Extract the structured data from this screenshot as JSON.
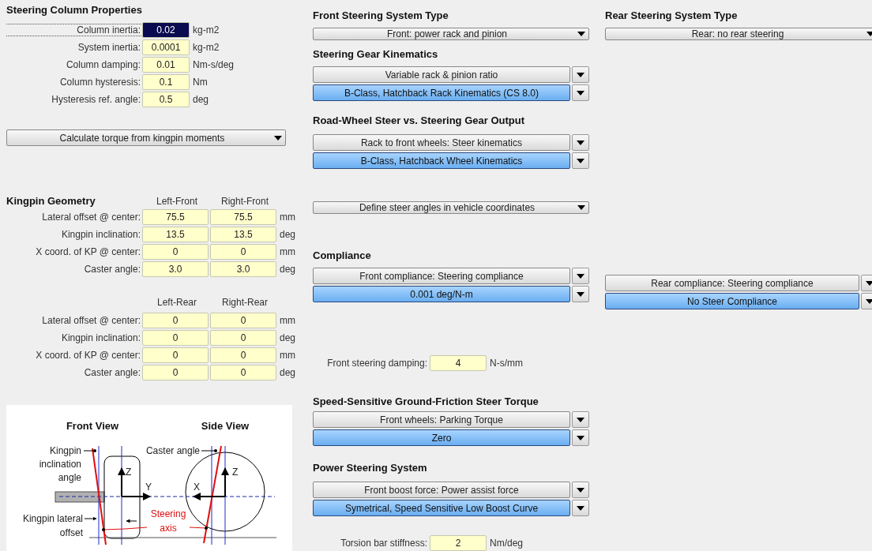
{
  "column_properties": {
    "title": "Steering Column Properties",
    "fields": [
      {
        "label": "Column inertia:",
        "value": "0.02",
        "unit": "kg-m2",
        "focused": true
      },
      {
        "label": "System inertia:",
        "value": "0.0001",
        "unit": "kg-m2",
        "focused": false
      },
      {
        "label": "Column damping:",
        "value": "0.01",
        "unit": "Nm-s/deg",
        "focused": false
      },
      {
        "label": "Column hysteresis:",
        "value": "0.1",
        "unit": "Nm",
        "focused": false
      },
      {
        "label": "Hysteresis ref. angle:",
        "value": "0.5",
        "unit": "deg",
        "focused": false
      }
    ],
    "dropdown": {
      "text": "Calculate torque from kingpin moments",
      "kind": "menu"
    }
  },
  "kingpin_geometry": {
    "title": "Kingpin Geometry",
    "front_headers": [
      "Left-Front",
      "Right-Front"
    ],
    "front_rows": [
      {
        "label": "Lateral offset @ center:",
        "values": [
          "75.5",
          "75.5"
        ],
        "unit": "mm"
      },
      {
        "label": "Kingpin inclination:",
        "values": [
          "13.5",
          "13.5"
        ],
        "unit": "deg"
      },
      {
        "label": "X coord. of KP @ center:",
        "values": [
          "0",
          "0"
        ],
        "unit": "mm"
      },
      {
        "label": "Caster angle:",
        "values": [
          "3.0",
          "3.0"
        ],
        "unit": "deg"
      }
    ],
    "rear_headers": [
      "Left-Rear",
      "Right-Rear"
    ],
    "rear_rows": [
      {
        "label": "Lateral offset @ center:",
        "values": [
          "0",
          "0"
        ],
        "unit": "mm"
      },
      {
        "label": "Kingpin inclination:",
        "values": [
          "0",
          "0"
        ],
        "unit": "deg"
      },
      {
        "label": "X coord. of KP @ center:",
        "values": [
          "0",
          "0"
        ],
        "unit": "mm"
      },
      {
        "label": "Caster angle:",
        "values": [
          "0",
          "0"
        ],
        "unit": "deg"
      }
    ]
  },
  "diagram": {
    "front_title": "Front View",
    "side_title": "Side View",
    "kingpin_inclination_label": [
      "Kingpin",
      "inclination",
      "angle"
    ],
    "caster_angle_label": "Caster angle",
    "lateral_offset_label": [
      "Kingpin lateral",
      "offset"
    ],
    "steering_axis_label": [
      "Steering",
      "axis"
    ],
    "front_axis_labels": [
      "Z",
      "Y"
    ],
    "side_axis_labels": [
      "X",
      "Z"
    ]
  },
  "front_steering_type": {
    "title": "Front Steering System Type",
    "dropdowns": [
      {
        "text": "Front: power rack and pinion",
        "kind": "menu"
      }
    ]
  },
  "steering_gear_kinematics": {
    "title": "Steering Gear Kinematics",
    "dropdowns": [
      {
        "text": "Variable rack & pinion ratio",
        "kind": "selector"
      },
      {
        "text": "B-Class, Hatchback Rack Kinematics (CS 8.0)",
        "kind": "dataset"
      }
    ]
  },
  "road_wheel_steer": {
    "title": "Road-Wheel Steer vs. Steering Gear Output",
    "dropdowns": [
      {
        "text": "Rack to front wheels: Steer kinematics",
        "kind": "selector"
      },
      {
        "text": "B-Class, Hatchback Wheel Kinematics",
        "kind": "dataset"
      }
    ]
  },
  "steer_angles_dropdown": {
    "text": "Define steer angles in vehicle coordinates",
    "kind": "menu"
  },
  "compliance": {
    "title": "Compliance",
    "front": [
      {
        "text": "Front compliance: Steering compliance",
        "kind": "selector"
      },
      {
        "text": "0.001 deg/N-m",
        "kind": "dataset"
      }
    ],
    "rear": [
      {
        "text": "Rear compliance: Steering compliance",
        "kind": "selector"
      },
      {
        "text": "No Steer Compliance",
        "kind": "dataset"
      }
    ]
  },
  "front_steering_damping": {
    "label": "Front steering damping:",
    "value": "4",
    "unit": "N-s/mm"
  },
  "ground_friction_torque": {
    "title": "Speed-Sensitive Ground-Friction Steer Torque",
    "dropdowns": [
      {
        "text": "Front wheels: Parking Torque",
        "kind": "selector"
      },
      {
        "text": "Zero",
        "kind": "dataset"
      }
    ]
  },
  "power_steering": {
    "title": "Power Steering System",
    "dropdowns": [
      {
        "text": "Front boost force: Power assist force",
        "kind": "selector"
      },
      {
        "text": "Symetrical, Speed Sensitive Low Boost Curve",
        "kind": "dataset"
      }
    ]
  },
  "torsion_bar": {
    "label": "Torsion bar stiffness:",
    "value": "2",
    "unit": "Nm/deg"
  },
  "rear_steering_type": {
    "title": "Rear Steering System Type",
    "dropdowns": [
      {
        "text": "Rear: no rear steering",
        "kind": "menu"
      }
    ]
  }
}
